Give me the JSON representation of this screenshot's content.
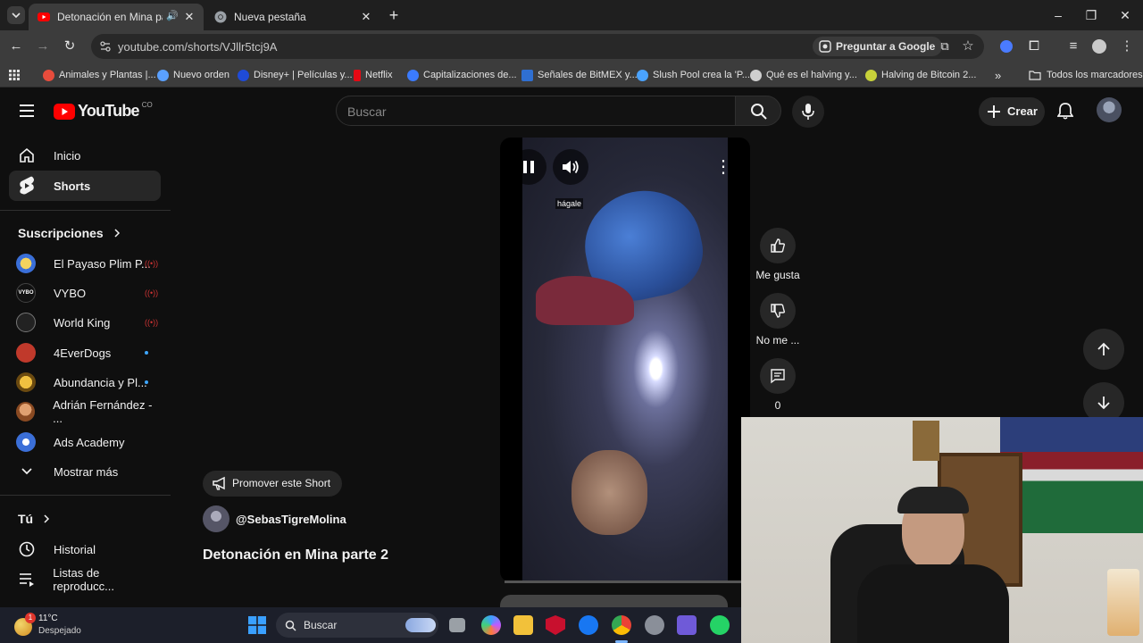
{
  "browser": {
    "tabs": [
      {
        "title": "Detonación en Mina parte 2",
        "active": true
      },
      {
        "title": "Nueva pestaña",
        "active": false
      }
    ],
    "url": "youtube.com/shorts/VJllr5tcj9A",
    "ask_google": "Preguntar a Google",
    "bookmarks": [
      {
        "label": "Animales y Plantas |...",
        "color": "#e74c3c"
      },
      {
        "label": "Nuevo orden",
        "color": "#5aa0ff"
      },
      {
        "label": "Disney+ | Películas y...",
        "color": "#1f4bd8"
      },
      {
        "label": "Netflix",
        "color": "#e50914"
      },
      {
        "label": "Capitalizaciones de...",
        "color": "#3b7bff"
      },
      {
        "label": "Señales de BitMEX y...",
        "color": "#2f6fd1"
      },
      {
        "label": "Slush Pool crea la 'P...",
        "color": "#4aa3ff"
      },
      {
        "label": "Qué es el halving y...",
        "color": "#cfcfcf"
      },
      {
        "label": "Halving de Bitcoin 2...",
        "color": "#c8d23a"
      }
    ],
    "all_bookmarks": "Todos los marcadores"
  },
  "youtube": {
    "logo_text": "YouTube",
    "country_code": "CO",
    "search_placeholder": "Buscar",
    "create_label": "Crear"
  },
  "sidebar": {
    "main": [
      {
        "label": "Inicio",
        "icon": "home-icon"
      },
      {
        "label": "Shorts",
        "icon": "shorts-icon",
        "active": true
      }
    ],
    "subscriptions_title": "Suscripciones",
    "subscriptions": [
      {
        "label": "El Payaso Plim P...",
        "indicator": "live",
        "color": "#e6b43a"
      },
      {
        "label": "VYBO",
        "indicator": "live",
        "color": "#111111"
      },
      {
        "label": "World King",
        "indicator": "live",
        "color": "#333333"
      },
      {
        "label": "4EverDogs",
        "indicator": "new",
        "color": "#c0392b"
      },
      {
        "label": "Abundancia y Pl...",
        "indicator": "new",
        "color": "#b8860b"
      },
      {
        "label": "Adrián Fernández - ...",
        "indicator": "none",
        "color": "#d08a55"
      },
      {
        "label": "Ads Academy",
        "indicator": "none",
        "color": "#3b6fd8"
      }
    ],
    "show_more": "Mostrar más",
    "you_title": "Tú",
    "you_items": [
      {
        "label": "Historial",
        "icon": "history-icon"
      },
      {
        "label": "Listas de reproducc...",
        "icon": "playlists-icon"
      }
    ]
  },
  "short": {
    "caption": "hágale",
    "promote": "Promover este Short",
    "channel": "@SebasTigreMolina",
    "title": "Detonación en Mina parte 2",
    "like_label": "Me gusta",
    "dislike_label": "No me ...",
    "comments_count": "0"
  },
  "taskbar": {
    "weather_temp": "11°C",
    "weather_desc": "Despejado",
    "weather_badge": "1",
    "search_label": "Buscar"
  }
}
